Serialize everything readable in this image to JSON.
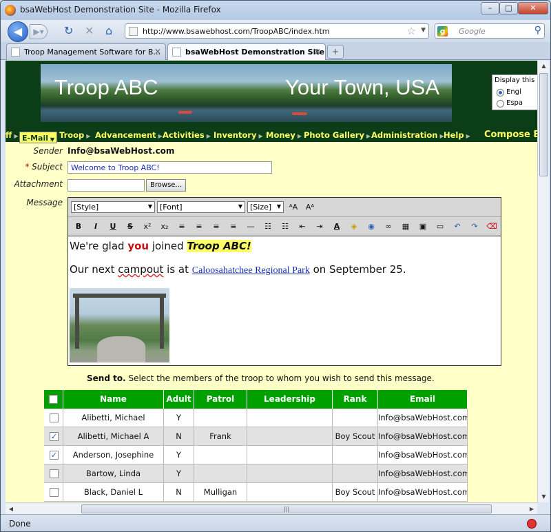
{
  "window": {
    "title": "bsaWebHost Demonstration Site - Mozilla Firefox",
    "buttons": {
      "minimize": "–",
      "maximize": "□",
      "close": "✕"
    }
  },
  "nav": {
    "url": "http://www.bsawebhost.com/TroopABC/index.htm",
    "search_placeholder": "Google",
    "search_engine": "g"
  },
  "tabs": [
    {
      "label": "Troop Management Software for B..."
    },
    {
      "label": "bsaWebHost Demonstration Site"
    }
  ],
  "banner": {
    "left_text": "Troop ABC",
    "right_text": "Your Town, USA",
    "language": {
      "title": "Display this",
      "options": [
        {
          "label": "Engl",
          "selected": true
        },
        {
          "label": "Espa",
          "selected": false
        }
      ]
    }
  },
  "menu": {
    "items": [
      {
        "label": "ff",
        "selected": false
      },
      {
        "label": "E-Mail",
        "selected": true
      },
      {
        "label": "Troop",
        "selected": false
      },
      {
        "label": "Advancement",
        "selected": false
      },
      {
        "label": "Activities",
        "selected": false
      },
      {
        "label": "Inventory",
        "selected": false
      },
      {
        "label": "Money",
        "selected": false
      },
      {
        "label": "Photo Gallery",
        "selected": false
      },
      {
        "label": "Administration",
        "selected": false
      },
      {
        "label": "Help",
        "selected": false
      }
    ],
    "compose": "Compose E"
  },
  "form": {
    "sender_label": "Sender",
    "sender_value": "Info@bsaWebHost.com",
    "subject_required": "*",
    "subject_label": "Subject",
    "subject_value": "Welcome to Troop ABC!",
    "attachment_label": "Attachment",
    "browse_label": "Browse...",
    "message_label": "Message"
  },
  "editor": {
    "style_select": "[Style]",
    "font_select": "[Font]",
    "size_select": "[Size]",
    "size_up": "ᴬA",
    "size_down": "Aᴬ",
    "tools": [
      "B",
      "I",
      "U",
      "S",
      "x²",
      "x₂",
      "≡",
      "≡",
      "≡",
      "≡",
      "—",
      "☷",
      "☷",
      "⇤",
      "⇥",
      "A",
      "◈",
      "◉",
      "∞",
      "▦",
      "▣",
      "▭",
      "↶",
      "↷",
      "⌫"
    ],
    "line1_a": "We're glad ",
    "line1_you": "you",
    "line1_b": " joined ",
    "line1_troop": "Troop ABC!",
    "line2_a": "Our next ",
    "line2_campout": "campout",
    "line2_b": " is at ",
    "line2_link": "Caloosahatchee Regional Park",
    "line2_c": " on September 25."
  },
  "sendto": {
    "bold": "Send to.",
    "text": "  Select the members of the troop to whom you wish to send this message."
  },
  "table": {
    "headers": [
      "",
      "Name",
      "Adult",
      "Patrol",
      "Leadership",
      "Rank",
      "Email"
    ],
    "rows": [
      {
        "checked": false,
        "name": "Alibetti, Michael",
        "adult": "Y",
        "patrol": "",
        "leadership": "",
        "rank": "",
        "email": "Info@bsaWebHost.com"
      },
      {
        "checked": true,
        "name": "Alibetti, Michael A",
        "adult": "N",
        "patrol": "Frank",
        "leadership": "",
        "rank": "Boy Scout",
        "email": "Info@bsaWebHost.com"
      },
      {
        "checked": true,
        "name": "Anderson, Josephine",
        "adult": "Y",
        "patrol": "",
        "leadership": "",
        "rank": "",
        "email": "Info@bsaWebHost.com"
      },
      {
        "checked": false,
        "name": "Bartow, Linda",
        "adult": "Y",
        "patrol": "",
        "leadership": "",
        "rank": "",
        "email": "Info@bsaWebHost.com"
      },
      {
        "checked": false,
        "name": "Black, Daniel L",
        "adult": "N",
        "patrol": "Mulligan",
        "leadership": "",
        "rank": "Boy Scout",
        "email": "Info@bsaWebHost.com"
      }
    ]
  },
  "status": {
    "text": "Done"
  },
  "colors": {
    "banner": "#0b3d16",
    "menu_text": "#ffff66",
    "table_header": "#00a000",
    "page_bg": "#ffffc8"
  }
}
